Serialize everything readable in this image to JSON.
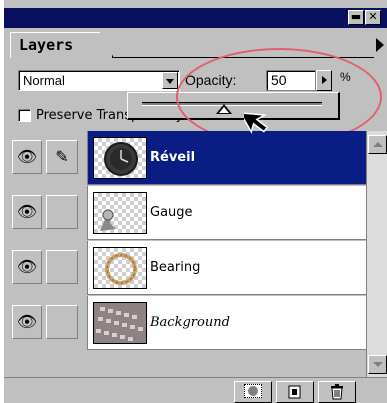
{
  "panel": {
    "title_buttons": {
      "minimize": "▬",
      "close": "✕"
    },
    "tabs": [
      {
        "label": "Layers"
      }
    ],
    "menu_icon": "triangle-right-icon"
  },
  "controls": {
    "blend_mode": "Normal",
    "opacity_label": "Opacity:",
    "opacity_value": "50",
    "opacity_unit": "%",
    "opacity_slider_level": 0.5,
    "preserve_label": "Preserve Transparency",
    "preserve_checked": false
  },
  "layers": [
    {
      "name": "Réveil",
      "visible": true,
      "brush": true,
      "selected": true,
      "italic": false,
      "thumbnail": "clock"
    },
    {
      "name": "Gauge",
      "visible": true,
      "brush": false,
      "selected": false,
      "italic": false,
      "thumbnail": "gauge"
    },
    {
      "name": "Bearing",
      "visible": true,
      "brush": false,
      "selected": false,
      "italic": false,
      "thumbnail": "bearing-ring"
    },
    {
      "name": "Background",
      "visible": true,
      "brush": false,
      "selected": false,
      "italic": true,
      "thumbnail": "keyboard-photo"
    }
  ],
  "footer": {
    "buttons": [
      {
        "icon": "layer-mask-icon"
      },
      {
        "icon": "new-layer-icon"
      },
      {
        "icon": "trash-icon"
      }
    ]
  },
  "colors": {
    "selection": "#0a1d85",
    "panel": "#c0c0c0",
    "annotation": "#e2606e",
    "titlebar": "#0a1060"
  }
}
